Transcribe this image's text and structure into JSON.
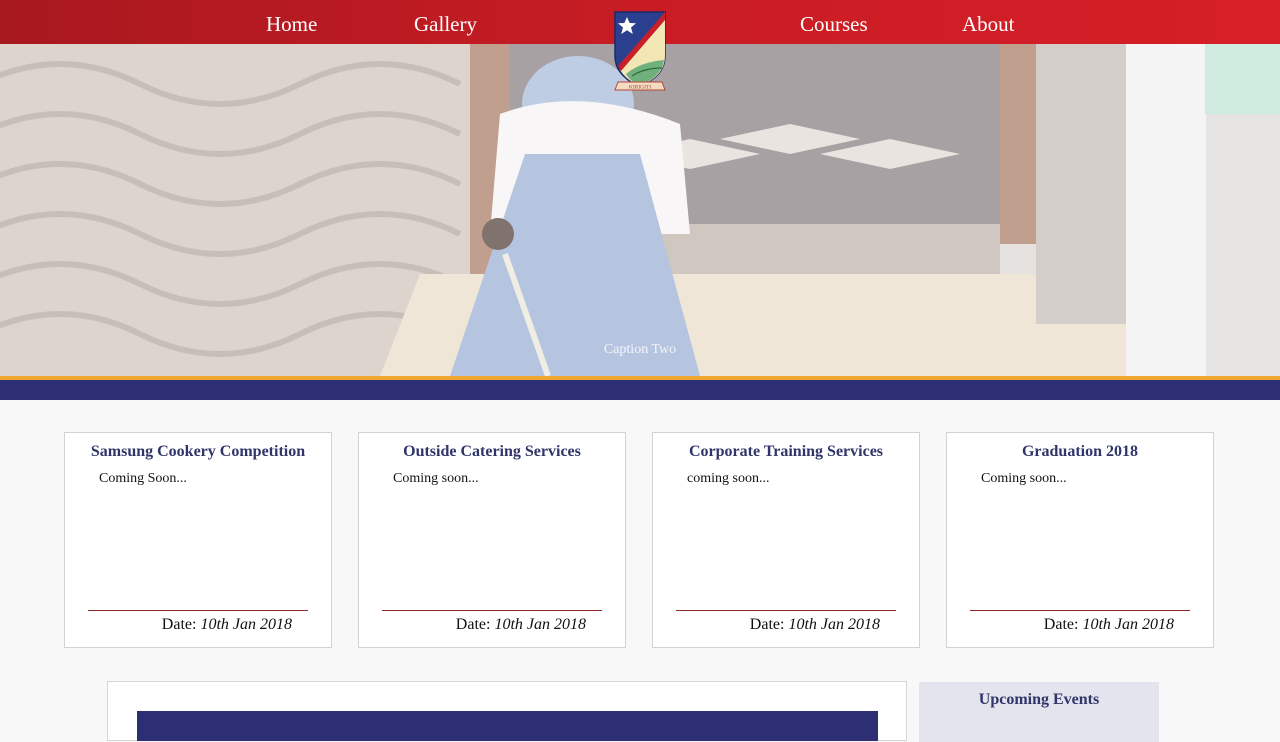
{
  "nav": {
    "items": [
      {
        "label": "Home"
      },
      {
        "label": "Gallery"
      },
      {
        "label": "Courses"
      },
      {
        "label": "About"
      }
    ],
    "crest_motto": "KIRIGITI"
  },
  "hero": {
    "caption": "Caption Two"
  },
  "cards": [
    {
      "title": "Samsung Cookery Competition",
      "desc": "Coming Soon...",
      "date_label": "Date:",
      "date": "10th Jan 2018"
    },
    {
      "title": "Outside Catering Services",
      "desc": "Coming soon...",
      "date_label": "Date:",
      "date": "10th Jan 2018"
    },
    {
      "title": "Corporate Training Services",
      "desc": "coming soon...",
      "date_label": "Date:",
      "date": "10th Jan 2018"
    },
    {
      "title": "Graduation 2018",
      "desc": "Coming soon...",
      "date_label": "Date:",
      "date": "10th Jan 2018"
    }
  ],
  "sidebar": {
    "events_title": "Upcoming Events"
  },
  "colors": {
    "nav_red": "#c81c24",
    "navy": "#2e2e74",
    "orange": "#f0a732",
    "title_blue": "#2f3569"
  },
  "icons": [
    "crest-logo",
    "star-icon"
  ]
}
